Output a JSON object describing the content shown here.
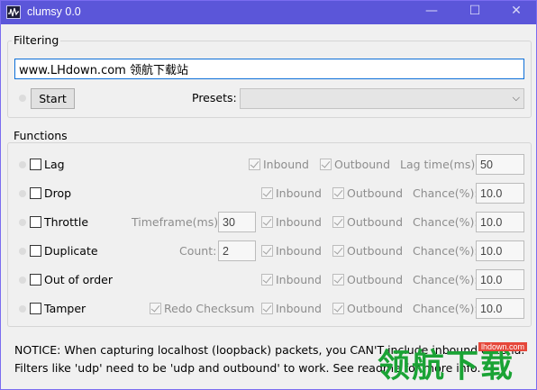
{
  "window": {
    "title": "clumsy 0.0"
  },
  "filtering": {
    "label": "Filtering",
    "filter_value": "www.LHdown.com 领航下载站",
    "start_label": "Start",
    "presets_label": "Presets:",
    "presets_value": ""
  },
  "functions": {
    "label": "Functions",
    "inbound": "Inbound",
    "outbound": "Outbound",
    "rows": [
      {
        "name": "Lag",
        "param_label": "Lag time(ms):",
        "param_value": "50"
      },
      {
        "name": "Drop",
        "param_label": "Chance(%):",
        "param_value": "10.0"
      },
      {
        "name": "Throttle",
        "extra_label": "Timeframe(ms):",
        "extra_value": "30",
        "param_label": "Chance(%):",
        "param_value": "10.0"
      },
      {
        "name": "Duplicate",
        "extra_label": "Count:",
        "extra_value": "2",
        "param_label": "Chance(%):",
        "param_value": "10.0"
      },
      {
        "name": "Out of order",
        "param_label": "Chance(%):",
        "param_value": "10.0"
      },
      {
        "name": "Tamper",
        "extra_label": "Redo Checksum",
        "param_label": "Chance(%):",
        "param_value": "10.0"
      }
    ]
  },
  "notice": {
    "line1": "NOTICE: When capturing localhost (loopback) packets, you CAN'T include inbound criteria.",
    "line2": "Filters like 'udp' need to be 'udp and outbound' to work. See readme for more info."
  },
  "watermark": {
    "text": "领航下载",
    "url": "lhdown.com"
  }
}
